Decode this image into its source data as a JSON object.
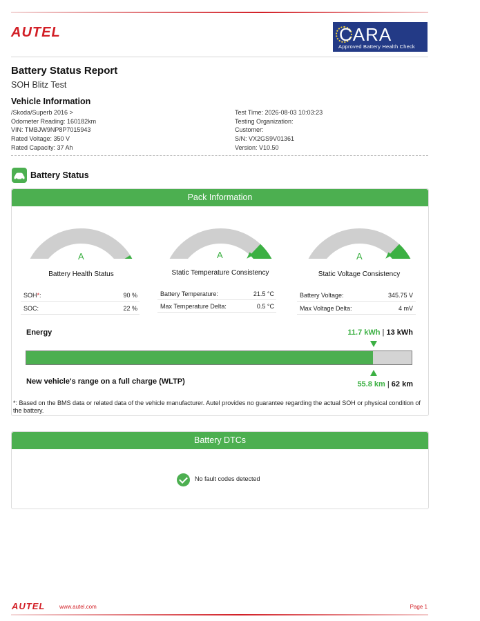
{
  "header": {
    "brand": "AUTEL",
    "cara": {
      "word": "CARA",
      "tagline": "Approved Battery Health Check"
    },
    "report_title": "Battery Status Report",
    "report_subtitle": "SOH Blitz Test"
  },
  "vehicle": {
    "heading": "Vehicle Information",
    "left": [
      "/Skoda/Superb 2016 >",
      "Odometer Reading: 160182km",
      "VIN: TMBJW9NP8P7015943",
      "Rated Voltage: 350 V",
      "Rated Capacity: 37 Ah"
    ],
    "right": [
      "Test Time: 2026-08-03 10:03:23",
      "Testing Organization:",
      "Customer:",
      "S/N: VX2GS9V01361",
      "Version: V10.50"
    ]
  },
  "battery_status": {
    "heading": "Battery Status",
    "pack_heading": "Pack Information",
    "gauges": [
      {
        "grade": "A",
        "label": "Battery Health Status",
        "level": 0.9
      },
      {
        "grade": "A",
        "label": "Static Temperature Consistency",
        "level": 0.8
      },
      {
        "grade": "A",
        "label": "Static Voltage Consistency",
        "level": 0.8
      }
    ],
    "metrics": [
      [
        {
          "key": "SOH",
          "mark": "*",
          "suffix": ":",
          "value": "90 %"
        },
        {
          "key": "SOC:",
          "value": "22 %"
        }
      ],
      [
        {
          "key": "Battery Temperature:",
          "value": "21.5 °C"
        },
        {
          "key": "Max Temperature Delta:",
          "value": "0.5 °C"
        }
      ],
      [
        {
          "key": "Battery Voltage:",
          "value": "345.75 V"
        },
        {
          "key": "Max Voltage Delta:",
          "value": "4 mV"
        }
      ]
    ],
    "energy": {
      "label": "Energy",
      "current": "11.7 kWh",
      "separator": " | ",
      "total": "13 kWh",
      "fill_fraction": 0.9
    },
    "range": {
      "label": "New vehicle's range on a full charge (WLTP)",
      "current": "55.8 km",
      "separator": " | ",
      "total": "62 km"
    },
    "footnote": "*: Based on the BMS data or related data of the vehicle manufacturer. Autel provides no guarantee regarding the actual SOH or physical condition of the battery."
  },
  "dtcs": {
    "heading": "Battery DTCs",
    "message": "No fault codes detected"
  },
  "footer": {
    "brand": "AUTEL",
    "url": "www.autel.com",
    "page": "Page 1"
  },
  "colors": {
    "accent_green": "#4caf50",
    "brand_red": "#d21f26",
    "cara_blue": "#233a86"
  }
}
